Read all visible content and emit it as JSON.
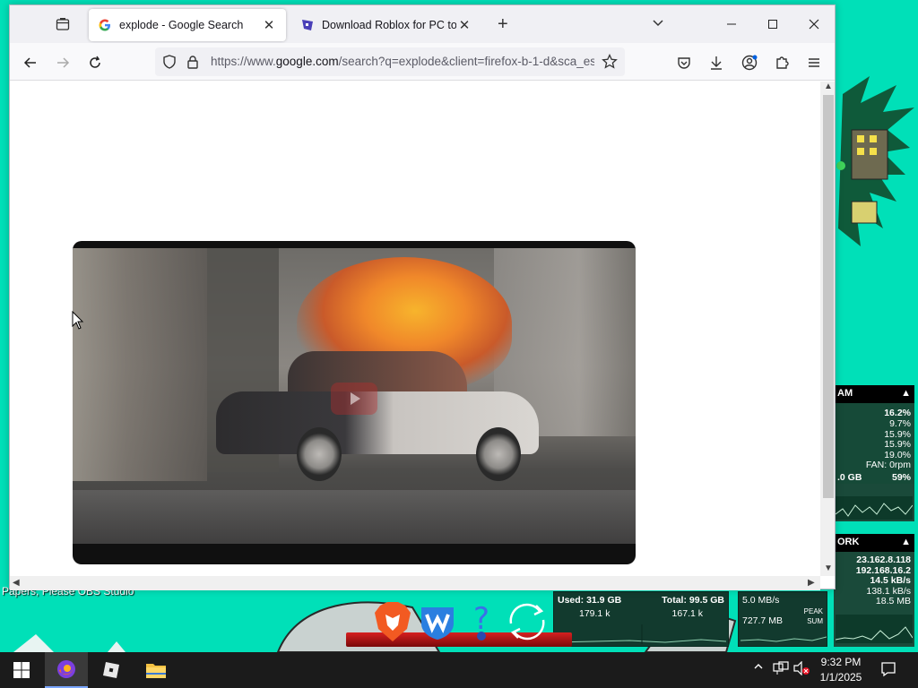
{
  "browser": {
    "tabs": [
      {
        "title": "explode - Google Search",
        "active": true
      },
      {
        "title": "Download Roblox for PC to Play",
        "active": false
      }
    ],
    "url_prefix": "https://www.",
    "url_domain": "google.com",
    "url_path": "/search?q=explode&client=firefox-b-1-d&sca_esv"
  },
  "desktop": {
    "label": "Papers, Please    OBS Studio"
  },
  "ram_widget": {
    "title": "AM",
    "values": [
      "16.2%",
      "9.7%",
      "15.9%",
      "15.9%",
      "19.0%"
    ],
    "fan": "FAN: 0rpm",
    "mem_left": ".0 GB",
    "mem_right": "59%"
  },
  "network_widget": {
    "title": "ORK",
    "ip1": "23.162.8.118",
    "ip2": "192.168.16.2",
    "rate": "14.5 kB/s",
    "up": "5.0 MB/s",
    "peak_label": "PEAK",
    "peak_val": "138.1 kB/s",
    "down_total": "727.7 MB",
    "sum_label": "SUM",
    "sum_val": "18.5 MB"
  },
  "disk_widget": {
    "used": "Used: 31.9 GB",
    "total": "Total: 99.5 GB",
    "left_val": "179.1 k",
    "right_val": "167.1 k"
  },
  "network_widget2": {
    "top_row": "..."
  },
  "taskbar": {
    "time": "9:32 PM",
    "date": "1/1/2025"
  },
  "colors": {
    "desktop": "#00e0b8",
    "accent": "#7aa6ff"
  }
}
